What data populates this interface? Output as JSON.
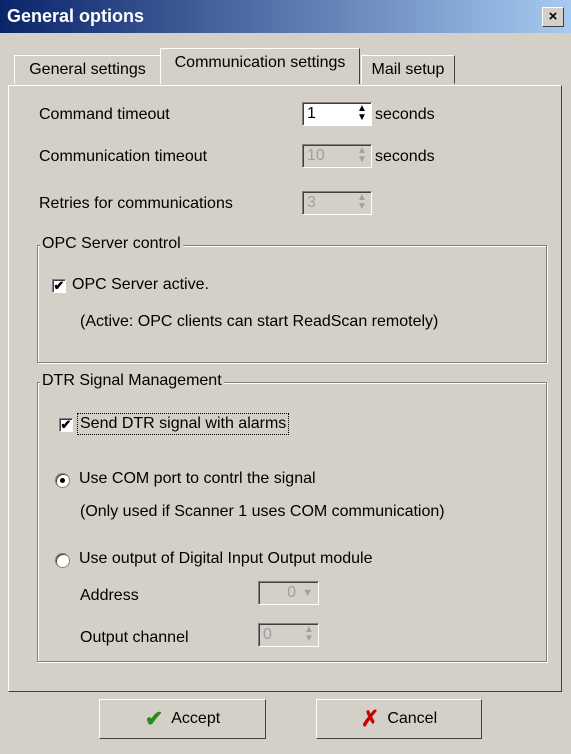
{
  "window": {
    "title": "General options",
    "close_glyph": "×"
  },
  "tabs": [
    {
      "label": "General settings",
      "active": false
    },
    {
      "label": "Communication settings",
      "active": true
    },
    {
      "label": "Mail setup",
      "active": false
    }
  ],
  "timeouts": {
    "command_label": "Command timeout",
    "command_value": "1",
    "command_unit": "seconds",
    "comm_label": "Communication timeout",
    "comm_value": "10",
    "comm_unit": "seconds",
    "retries_label": "Retries for communications",
    "retries_value": "3"
  },
  "opc": {
    "group_title": "OPC Server control",
    "active_label": "OPC Server active.",
    "active_checked": true,
    "note": "(Active: OPC clients can start ReadScan remotely)"
  },
  "dtr": {
    "group_title": "DTR Signal Management",
    "send_label": "Send DTR signal with alarms",
    "send_checked": true,
    "com_label": "Use COM port to contrl the signal",
    "com_note": "(Only used if Scanner 1 uses COM communication)",
    "com_selected": true,
    "dio_label": "Use output of Digital Input Output module",
    "dio_selected": false,
    "address_label": "Address",
    "address_value": "0",
    "output_label": "Output channel",
    "output_value": "0"
  },
  "buttons": {
    "accept_label": "Accept",
    "cancel_label": "Cancel"
  },
  "icons": {
    "accept": "check-icon",
    "cancel": "x-icon"
  },
  "colors": {
    "title_start": "#0a246a",
    "title_end": "#a6caf0",
    "face": "#d4d0c8",
    "accept_icon": "#2a8a1a",
    "cancel_icon": "#cc0000"
  }
}
